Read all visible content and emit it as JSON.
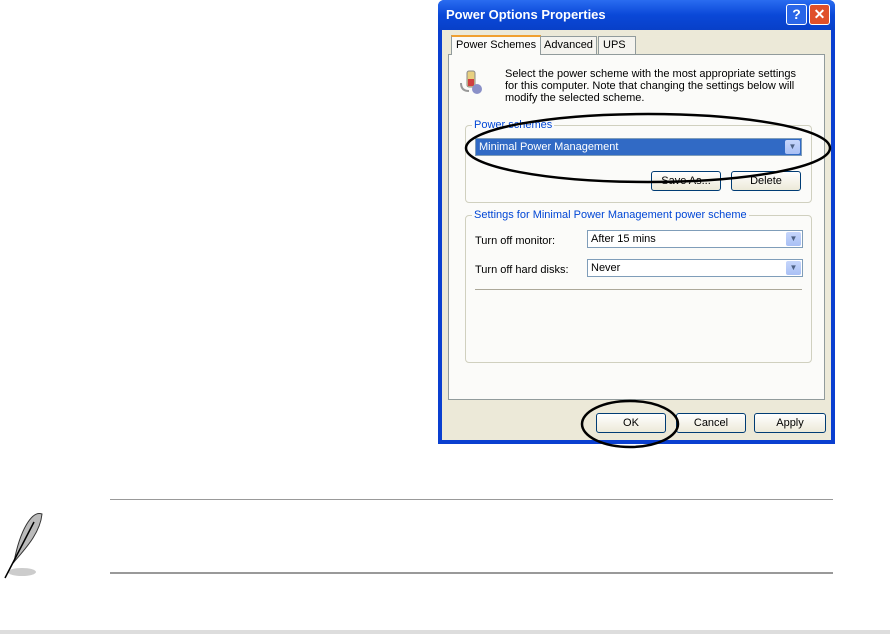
{
  "dialog": {
    "title": "Power Options Properties",
    "help": "?",
    "close": "✕",
    "tabs": [
      "Power Schemes",
      "Advanced",
      "UPS"
    ],
    "description": "Select the power scheme with the most appropriate settings for this computer. Note that changing the settings below will modify the selected scheme.",
    "schemes_group": {
      "label": "Power schemes",
      "selected": "Minimal Power Management",
      "save_as": "Save As...",
      "delete": "Delete"
    },
    "settings_group": {
      "label": "Settings for Minimal Power Management power scheme",
      "monitor_label": "Turn off monitor:",
      "monitor_value": "After 15 mins",
      "disks_label": "Turn off hard disks:",
      "disks_value": "Never"
    },
    "buttons": {
      "ok": "OK",
      "cancel": "Cancel",
      "apply": "Apply"
    }
  },
  "note": {
    "icon": "feather-quill-icon"
  }
}
